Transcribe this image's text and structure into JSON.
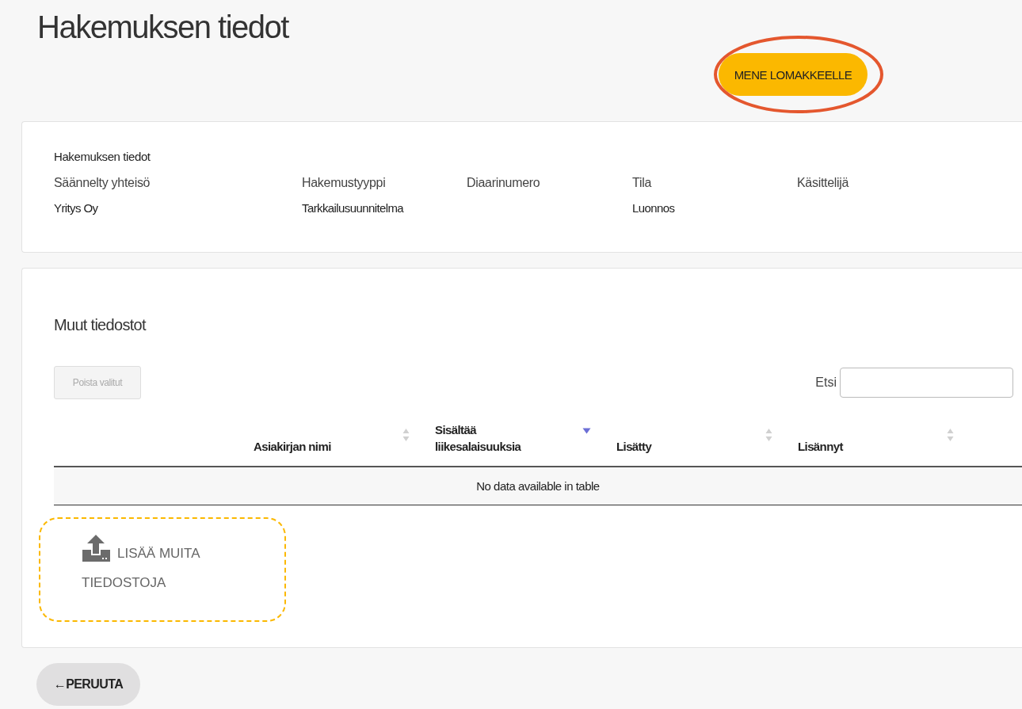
{
  "page_title": "Hakemuksen tiedot",
  "go_button": {
    "label": "MENE LOMAKKEELLE",
    "highlighted": true
  },
  "info_card": {
    "title": "Hakemuksen tiedot",
    "fields": [
      {
        "label": "Säännelty yhteisö",
        "value": "Yritys Oy"
      },
      {
        "label": "Hakemustyyppi",
        "value": "Tarkkailusuunnitelma"
      },
      {
        "label": "Diaarinumero"
      },
      {
        "label": "Tila",
        "value": "Luonnos"
      },
      {
        "label": "Käsittelijä"
      }
    ]
  },
  "files_card": {
    "title": "Muut tiedostot",
    "delete_button": {
      "label": "Poista valitut",
      "disabled": true
    },
    "search": {
      "label": "Etsi"
    },
    "table": {
      "columns": [
        {
          "label": "Asiakirjan nimi",
          "sortable": true,
          "sorted": false
        },
        {
          "label": "Sisältää\nliikesalaisuuksia",
          "sortable": true,
          "sorted": true
        },
        {
          "label": "Lisätty",
          "sortable": true,
          "sorted": false
        },
        {
          "label": "Lisännyt",
          "sortable": true,
          "sorted": false
        }
      ],
      "empty_message": "No data available in table"
    },
    "upload": {
      "label": "LISÄÄ MUITA TIEDOSTOJA"
    }
  },
  "cancel_button": {
    "label": "←PERUUTA"
  }
}
